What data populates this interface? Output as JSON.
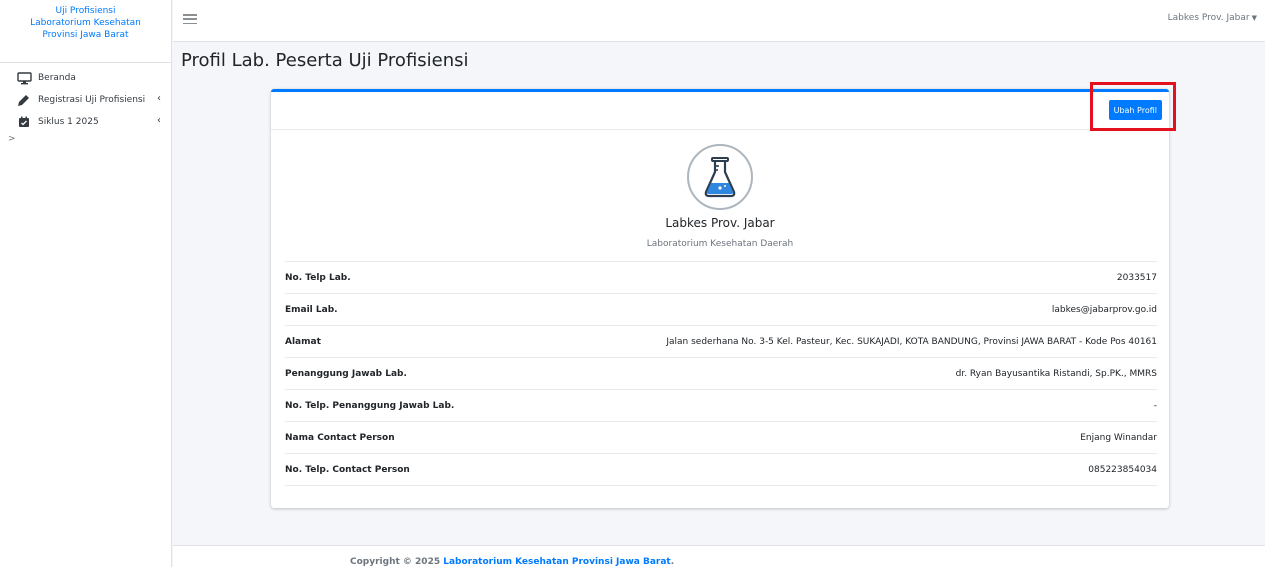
{
  "sidebar": {
    "brand_lines": [
      "Uji Profisiensi",
      "Laboratorium Kesehatan",
      "Provinsi Jawa Barat"
    ],
    "items": [
      {
        "label": "Beranda",
        "icon": "monitor-icon"
      },
      {
        "label": "Registrasi Uji Profisiensi",
        "icon": "pencil-icon"
      },
      {
        "label": "Siklus 1 2025",
        "icon": "calendar-check-icon"
      }
    ],
    "expander": ">"
  },
  "topbar": {
    "user": "Labkes Prov. Jabar"
  },
  "page": {
    "title": "Profil Lab. Peserta Uji Profisiensi"
  },
  "card": {
    "edit_button": "Ubah Profil",
    "name": "Labkes Prov. Jabar",
    "type": "Laboratorium Kesehatan Daerah",
    "avatar_icon": "flask-icon",
    "rows": [
      {
        "label": "No. Telp Lab.",
        "value": "2033517"
      },
      {
        "label": "Email Lab.",
        "value": "labkes@jabarprov.go.id"
      },
      {
        "label": "Alamat",
        "value": "Jalan sederhana No. 3-5 Kel. Pasteur, Kec. SUKAJADI, KOTA BANDUNG, Provinsi JAWA BARAT - Kode Pos 40161"
      },
      {
        "label": "Penanggung Jawab Lab.",
        "value": "dr. Ryan Bayusantika Ristandi, Sp.PK., MMRS"
      },
      {
        "label": "No. Telp. Penanggung Jawab Lab.",
        "value": "-"
      },
      {
        "label": "Nama Contact Person",
        "value": "Enjang Winandar"
      },
      {
        "label": "No. Telp. Contact Person",
        "value": "085223854034"
      }
    ]
  },
  "footer": {
    "prefix": "Copyright © 2025",
    "link": "Laboratorium Kesehatan Provinsi Jawa Barat",
    "suffix": "."
  },
  "colors": {
    "primary": "#007bff",
    "highlight": "#e4101e",
    "background": "#f4f6f9"
  }
}
